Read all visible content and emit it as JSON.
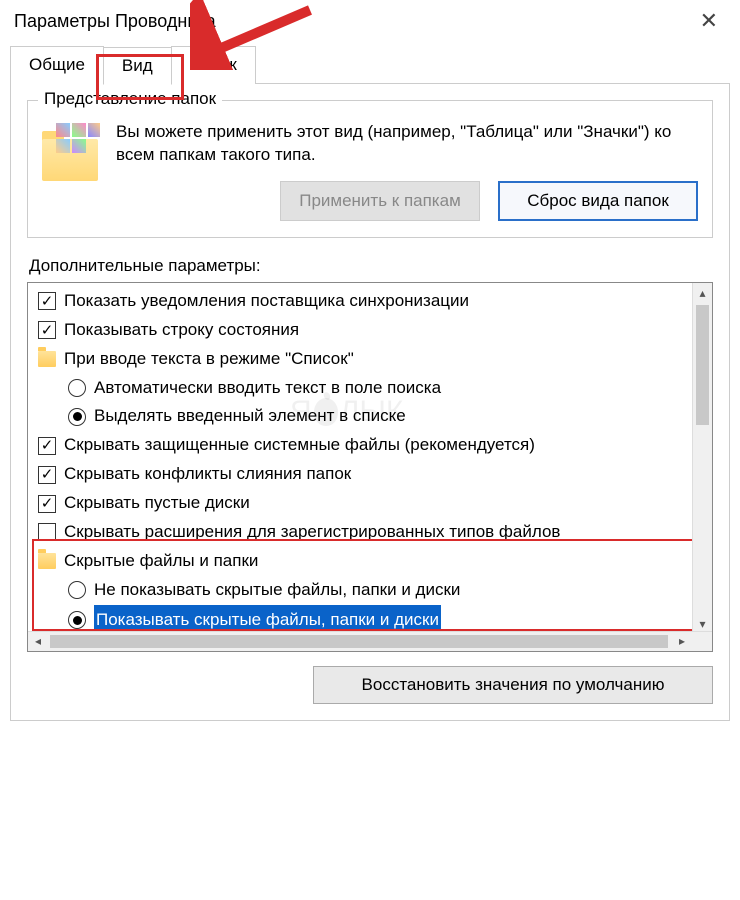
{
  "window": {
    "title": "Параметры Проводника"
  },
  "tabs": {
    "general": "Общие",
    "view": "Вид",
    "search": "Поиск"
  },
  "folder_views": {
    "legend": "Представление папок",
    "text": "Вы можете применить этот вид (например, \"Таблица\" или \"Значки\") ко всем папкам такого типа.",
    "apply_btn": "Применить к папкам",
    "reset_btn": "Сброс вида папок"
  },
  "advanced": {
    "label": "Дополнительные параметры:",
    "items": {
      "sync_notify": "Показать уведомления поставщика синхронизации",
      "status_bar": "Показывать строку состояния",
      "list_typing": "При вводе текста в режиме \"Список\"",
      "auto_search": "Автоматически вводить текст в поле поиска",
      "select_typed": "Выделять введенный элемент в списке",
      "hide_protected": "Скрывать защищенные системные файлы (рекомендуется)",
      "hide_merge": "Скрывать конфликты слияния папок",
      "hide_empty": "Скрывать пустые диски",
      "hide_ext": "Скрывать расширения для зарегистрированных типов файлов",
      "hidden_group": "Скрытые файлы и папки",
      "dont_show": "Не показывать скрытые файлы, папки и диски",
      "show_hidden": "Показывать скрытые файлы, папки и диски"
    }
  },
  "restore_defaults": "Восстановить значения по умолчанию",
  "watermark": {
    "left": "Я",
    "right": "ЛЫК"
  }
}
